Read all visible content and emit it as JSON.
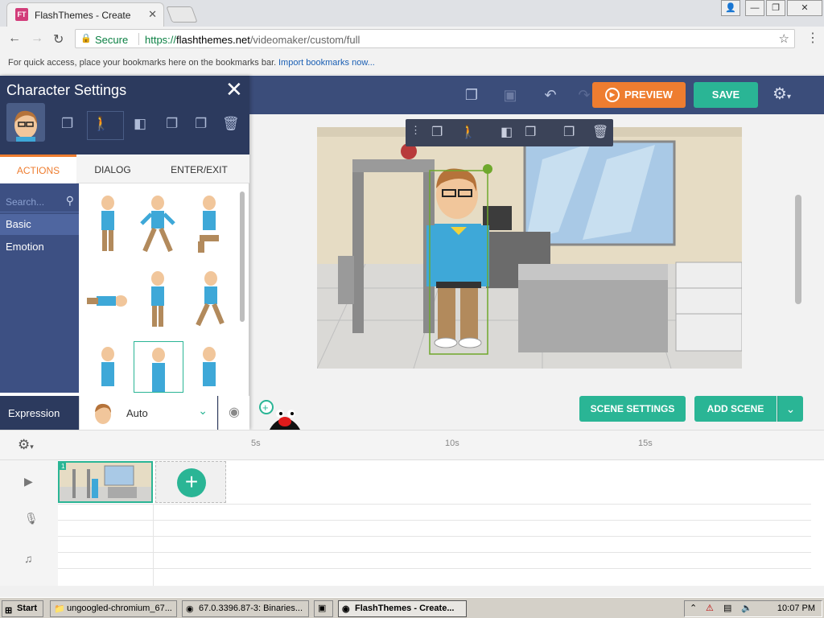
{
  "browser": {
    "tab_title": "FlashThemes - Create",
    "tab_favicon": "FT",
    "secure_label": "Secure",
    "url_prefix": "https://",
    "url_host": "flashthemes.net",
    "url_path": "/videomaker/custom/full",
    "bookmarks_hint": "For quick access, place your bookmarks here on the bookmarks bar.",
    "bookmarks_link": "Import bookmarks now..."
  },
  "toolbar": {
    "preview_label": "PREVIEW",
    "save_label": "SAVE"
  },
  "panel": {
    "title": "Character Settings",
    "tabs": [
      "ACTIONS",
      "DIALOG",
      "ENTER/EXIT"
    ],
    "active_tab": "ACTIONS",
    "search_placeholder": "Search...",
    "categories": [
      "Basic",
      "Emotion"
    ],
    "selected_category": "Basic",
    "expression_label": "Expression",
    "expression_value": "Auto"
  },
  "stage": {
    "scene_settings_label": "SCENE SETTINGS",
    "add_scene_label": "ADD SCENE"
  },
  "timeline": {
    "ticks": [
      "5s",
      "10s",
      "15s"
    ],
    "scene_number": "1"
  },
  "taskbar": {
    "start_label": "Start",
    "items": [
      "ungoogled-chromium_67...",
      "67.0.3396.87-3: Binaries...",
      "",
      "FlashThemes - Create..."
    ],
    "clock": "10:07 PM"
  },
  "colors": {
    "accent_teal": "#2ab595",
    "accent_orange": "#ee7d30",
    "header_navy": "#3b4d7a",
    "panel_navy": "#2c3a5e"
  }
}
